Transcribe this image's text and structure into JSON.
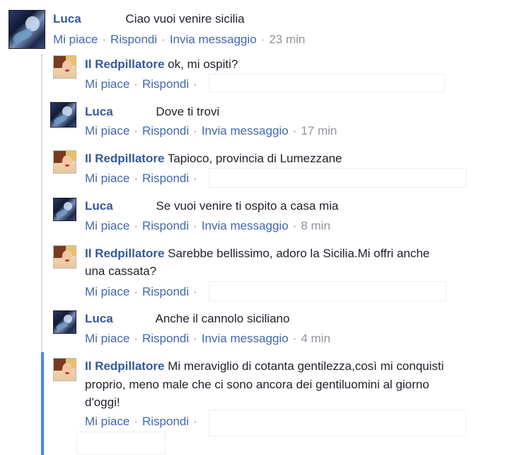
{
  "labels": {
    "like": "Mi piace",
    "reply": "Rispondi",
    "message": "Invia messaggio",
    "dot": "·"
  },
  "comments": [
    {
      "author": "Luca",
      "text": "Ciao vuoi venire sicilia",
      "time": "23 min"
    },
    {
      "author": "Il Redpillatore",
      "text": "ok, mi ospiti?"
    },
    {
      "author": "Luca",
      "text": "Dove ti trovi",
      "time": "17 min"
    },
    {
      "author": "Il Redpillatore",
      "text": "Tapioco, provincia di Lumezzane"
    },
    {
      "author": "Luca",
      "text": "Se vuoi venire ti ospito a casa mia",
      "time": "8 min"
    },
    {
      "author": "Il Redpillatore",
      "text_line1": "Sarebbe bellissimo, adoro la Sicilia.Mi offri anche",
      "text_line2": "una cassata?"
    },
    {
      "author": "Luca",
      "text": "Anche il cannolo siciliano",
      "time": "4 min"
    },
    {
      "author": "Il Redpillatore",
      "text_line1": "Mi meraviglio di cotanta gentilezza,così mi conquisti",
      "text_line2": "proprio, meno male che ci sono ancora dei gentiluomini al giorno",
      "text_line3": "d'oggi!"
    }
  ]
}
